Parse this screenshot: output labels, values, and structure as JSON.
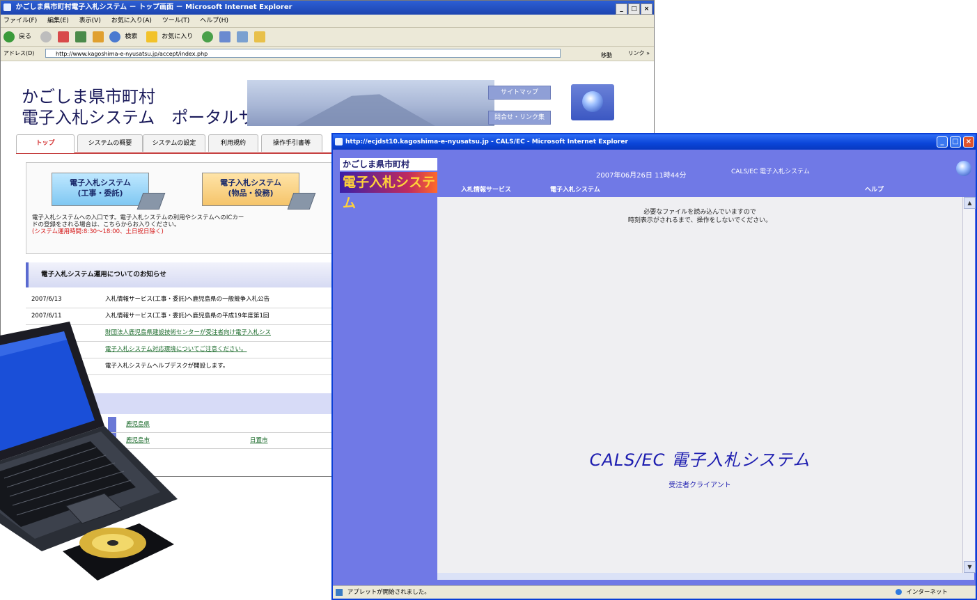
{
  "back_window": {
    "title": "かごしま県市町村電子入札システム － トップ画面 － Microsoft Internet Explorer",
    "menu": [
      "ファイル(F)",
      "編集(E)",
      "表示(V)",
      "お気に入り(A)",
      "ツール(T)",
      "ヘルプ(H)"
    ],
    "toolbar": {
      "back": "戻る",
      "search": "検索",
      "favorites": "お気に入り"
    },
    "address_label": "アドレス(D)",
    "address_url": "http://www.kagoshima-e-nyusatsu.jp/accept/index.php",
    "go_label": "移動",
    "links_label": "リンク »",
    "portal": {
      "title_line1": "かごしま県市町村",
      "title_line2": "電子入札システム　ポータルサイト",
      "sitemap": "サイトマップ",
      "contact": "問合せ・リンク集",
      "tabs": [
        "トップ",
        "システムの概要",
        "システムの設定",
        "利用規約",
        "操作手引書等"
      ],
      "card1_line1": "電子入札システム",
      "card1_line2": "(工事・委託)",
      "card2_line1": "電子入札システム",
      "card2_line2": "(物品・役務)",
      "desc_line1": "電子入札システムへの入口です。電子入札システムの利用やシステムへのICカー",
      "desc_line2": "ドの登録をされる場合は、こちらからお入りください。",
      "desc_hours": "(システム運用時間:8:30～18:00、土日祝日除く)",
      "news_heading": "電子入札システム運用についてのお知らせ",
      "news": [
        {
          "date": "2007/6/13",
          "text": "入札情報サービス(工事・委託)へ鹿児島県の一般競争入札公告"
        },
        {
          "date": "2007/6/11",
          "text": "入札情報サービス(工事・委託)へ鹿児島県の平成19年度第1回"
        },
        {
          "date": "",
          "text": "財団法人鹿児島県建設技術センターが受注者向け電子入札シス"
        },
        {
          "date": "",
          "text": "電子入札システム対応環境についてご注意ください。"
        },
        {
          "date": "",
          "text": "電子入札システムヘルプデスクが開設します。"
        }
      ],
      "muni1": "鹿児島県",
      "muni2": "鹿児島市",
      "muni3": "日置市"
    }
  },
  "front_window": {
    "title": "http://ecjdst10.kagoshima-e-nyusatsu.jp - CALS/EC - Microsoft Internet Explorer",
    "logo_line1": "かごしま県市町村",
    "logo_line2": "電子入札システム",
    "datetime": "2007年06月26日 11時44分",
    "system_name": "CALS/EC 電子入札システム",
    "nav": {
      "info": "入札情報サービス",
      "ebid": "電子入札システム",
      "help": "ヘルプ"
    },
    "loading_line1": "必要なファイルを読み込んでいますので",
    "loading_line2": "時刻表示がされるまで、操作をしないでください。",
    "main_title": "CALS/EC 電子入札システム",
    "subtitle": "受注者クライアント",
    "status_text": "アプレットが開始されました。",
    "status_zone": "インターネット"
  }
}
